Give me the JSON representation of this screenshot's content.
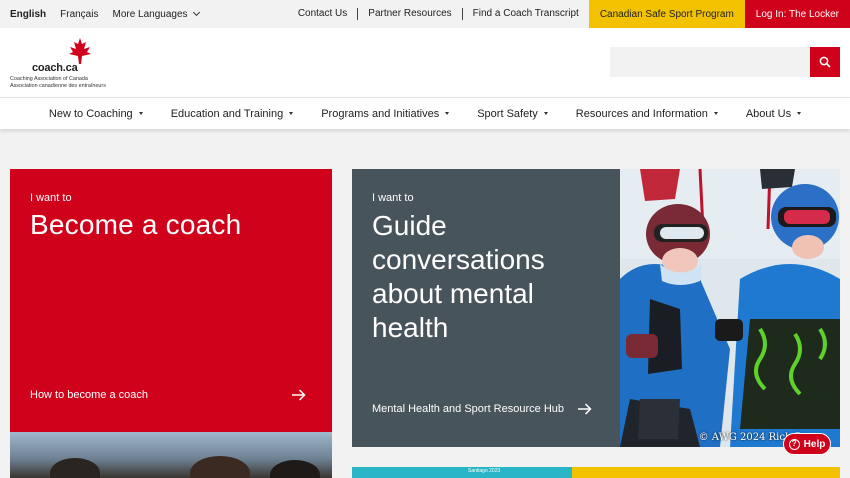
{
  "utility": {
    "lang_en": "English",
    "lang_fr": "Français",
    "more_languages": "More Languages",
    "contact": "Contact Us",
    "partner": "Partner Resources",
    "transcript": "Find a Coach Transcript",
    "safe_sport": "Canadian Safe Sport Program",
    "login": "Log In: The Locker"
  },
  "logo": {
    "wordmark_a": "coach",
    "wordmark_b": ".ca",
    "line1": "Coaching Association of Canada",
    "line2": "Association canadienne des entraîneurs"
  },
  "search": {
    "placeholder": ""
  },
  "nav": {
    "items": [
      "New to Coaching",
      "Education and Training",
      "Programs and Initiatives",
      "Sport Safety",
      "Resources and Information",
      "About Us"
    ]
  },
  "cards": {
    "red": {
      "kicker": "I want to",
      "headline": "Become a coach",
      "cta": "How to become a coach"
    },
    "gray": {
      "kicker": "I want to",
      "headline": "Guide conversations about mental health",
      "cta": "Mental Health and Sport Resource Hub"
    }
  },
  "photo": {
    "credit": "© AWG 2024 Rich Ryan"
  },
  "thumb": {
    "label": "Santiago 2023"
  },
  "help": {
    "label": "Help"
  },
  "colors": {
    "brand_red": "#d0021b",
    "safe_yellow": "#f2c200",
    "slate": "#48545c"
  }
}
